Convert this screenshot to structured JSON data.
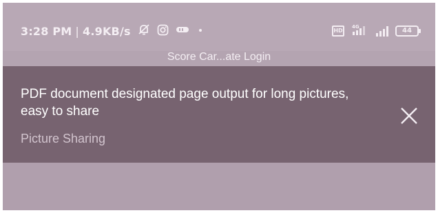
{
  "status_bar": {
    "time": "3:28 PM",
    "separator": "|",
    "network_speed": "4.9KB/s",
    "left_icons": [
      "alarm-off-icon",
      "instagram-icon",
      "hd-voice-icon",
      "dot-icon"
    ],
    "right_icons": [
      "volte-icon",
      "signal-4g-icon",
      "signal-bars-icon",
      "battery-icon"
    ],
    "hd_label": "HD",
    "battery_level": "44"
  },
  "app": {
    "title": "Score Car...ate Login"
  },
  "notification": {
    "title": "PDF document designated page output for long pictures, easy to share",
    "subtitle": "Picture Sharing",
    "close_icon": "close-icon"
  },
  "colors": {
    "screen_bg": "#b4a4b1",
    "notification_bg": "#776370",
    "text_light": "#f4eef3"
  }
}
